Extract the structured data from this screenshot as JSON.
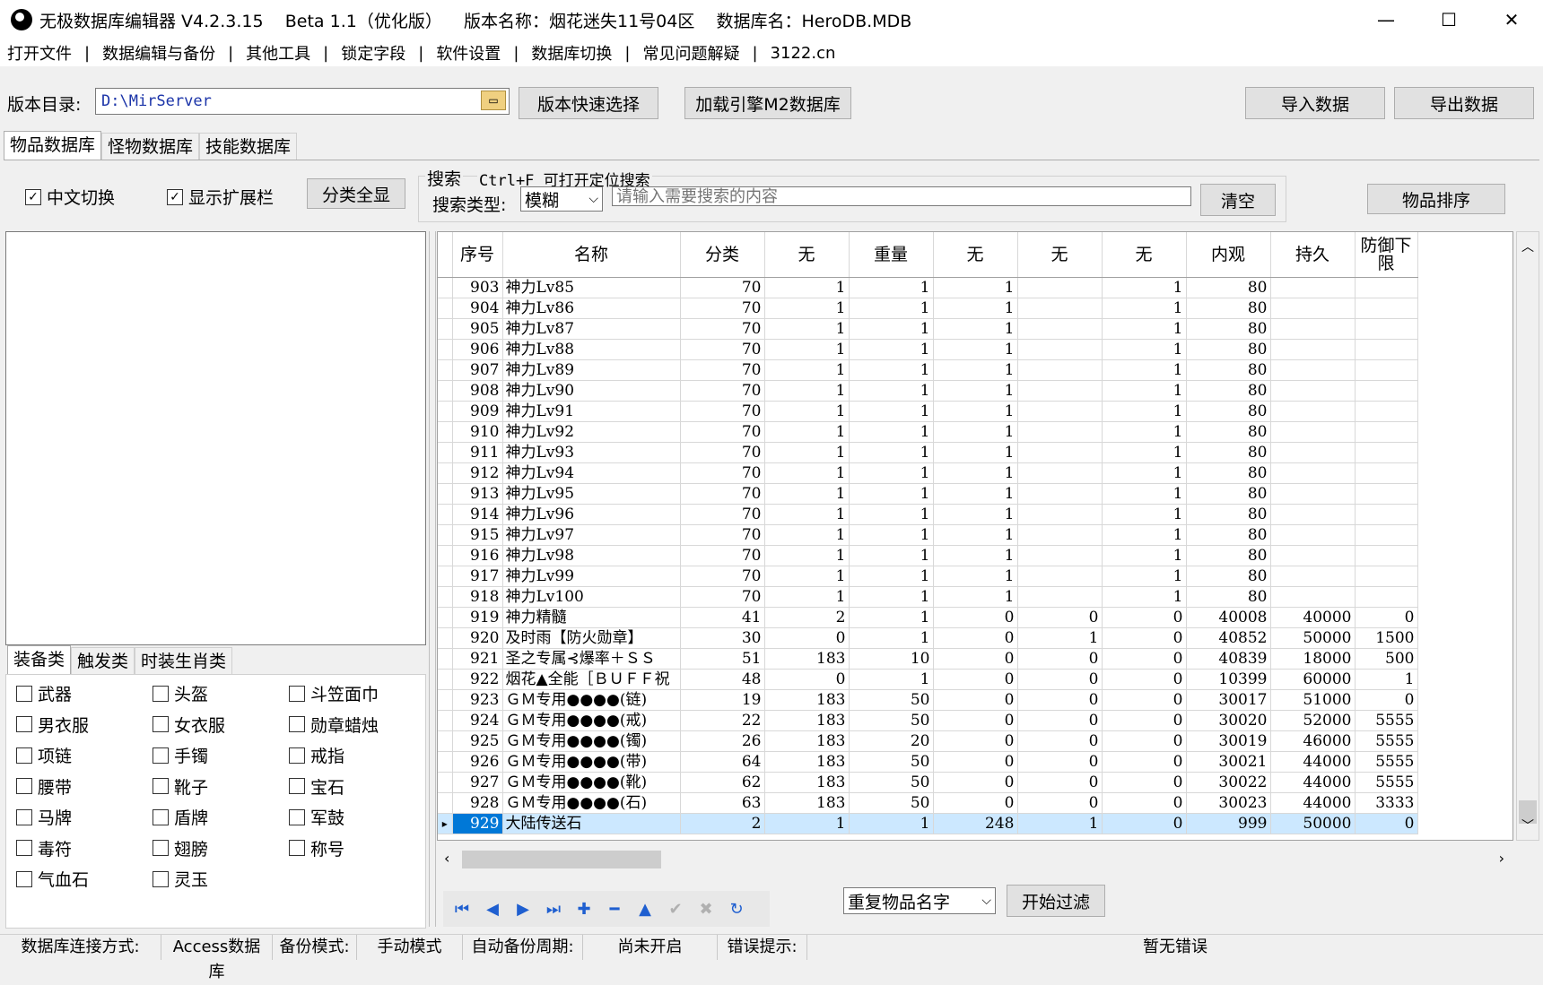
{
  "titlebar": {
    "title": "无极数据库编辑器 V4.2.3.15    Beta 1.1（优化版）    版本名称：烟花迷失11号04区    数据库名：HeroDB.MDB",
    "minimize": "—",
    "maximize": "☐",
    "close": "✕"
  },
  "menu": {
    "items": [
      "打开文件",
      "数据编辑与备份",
      "其他工具",
      "锁定字段",
      "软件设置",
      "数据库切换",
      "常见问题解疑",
      "3122.cn"
    ],
    "separator": "|"
  },
  "toolbar": {
    "dir_label": "版本目录:",
    "dir_value": "D:\\MirServer",
    "quick_select": "版本快速选择",
    "load_m2": "加载引擎M2数据库",
    "import": "导入数据",
    "export": "导出数据"
  },
  "tabs": [
    "物品数据库",
    "怪物数据库",
    "技能数据库"
  ],
  "options": {
    "chinese_switch": "中文切换",
    "show_ext": "显示扩展栏",
    "show_all": "分类全显",
    "search_title": "搜索",
    "search_hint": "Ctrl+F 可打开定位搜索",
    "search_type_label": "搜索类型:",
    "search_type": "模糊",
    "search_placeholder": "请输入需要搜索的内容",
    "clear": "清空",
    "sort": "物品排序"
  },
  "category_tabs": [
    "装备类",
    "触发类",
    "时装生肖类"
  ],
  "categories": [
    "武器",
    "头盔",
    "斗笠面巾",
    "男衣服",
    "女衣服",
    "勋章蜡烛",
    "项链",
    "手镯",
    "戒指",
    "腰带",
    "靴子",
    "宝石",
    "马牌",
    "盾牌",
    "军鼓",
    "毒符",
    "翅膀",
    "称号",
    "气血石",
    "灵玉"
  ],
  "grid": {
    "columns": [
      "序号",
      "名称",
      "分类",
      "无",
      "重量",
      "无",
      "无",
      "无",
      "内观",
      "持久",
      "防御下限"
    ],
    "rows": [
      [
        "903",
        "神力Lv85",
        "70",
        "1",
        "1",
        "1",
        "",
        "1",
        "80",
        "",
        ""
      ],
      [
        "904",
        "神力Lv86",
        "70",
        "1",
        "1",
        "1",
        "",
        "1",
        "80",
        "",
        ""
      ],
      [
        "905",
        "神力Lv87",
        "70",
        "1",
        "1",
        "1",
        "",
        "1",
        "80",
        "",
        ""
      ],
      [
        "906",
        "神力Lv88",
        "70",
        "1",
        "1",
        "1",
        "",
        "1",
        "80",
        "",
        ""
      ],
      [
        "907",
        "神力Lv89",
        "70",
        "1",
        "1",
        "1",
        "",
        "1",
        "80",
        "",
        ""
      ],
      [
        "908",
        "神力Lv90",
        "70",
        "1",
        "1",
        "1",
        "",
        "1",
        "80",
        "",
        ""
      ],
      [
        "909",
        "神力Lv91",
        "70",
        "1",
        "1",
        "1",
        "",
        "1",
        "80",
        "",
        ""
      ],
      [
        "910",
        "神力Lv92",
        "70",
        "1",
        "1",
        "1",
        "",
        "1",
        "80",
        "",
        ""
      ],
      [
        "911",
        "神力Lv93",
        "70",
        "1",
        "1",
        "1",
        "",
        "1",
        "80",
        "",
        ""
      ],
      [
        "912",
        "神力Lv94",
        "70",
        "1",
        "1",
        "1",
        "",
        "1",
        "80",
        "",
        ""
      ],
      [
        "913",
        "神力Lv95",
        "70",
        "1",
        "1",
        "1",
        "",
        "1",
        "80",
        "",
        ""
      ],
      [
        "914",
        "神力Lv96",
        "70",
        "1",
        "1",
        "1",
        "",
        "1",
        "80",
        "",
        ""
      ],
      [
        "915",
        "神力Lv97",
        "70",
        "1",
        "1",
        "1",
        "",
        "1",
        "80",
        "",
        ""
      ],
      [
        "916",
        "神力Lv98",
        "70",
        "1",
        "1",
        "1",
        "",
        "1",
        "80",
        "",
        ""
      ],
      [
        "917",
        "神力Lv99",
        "70",
        "1",
        "1",
        "1",
        "",
        "1",
        "80",
        "",
        ""
      ],
      [
        "918",
        "神力Lv100",
        "70",
        "1",
        "1",
        "1",
        "",
        "1",
        "80",
        "",
        ""
      ],
      [
        "919",
        "神力精髓",
        "41",
        "2",
        "1",
        "0",
        "0",
        "0",
        "40008",
        "40000",
        "0"
      ],
      [
        "920",
        "及时雨【防火勋章】",
        "30",
        "0",
        "1",
        "0",
        "1",
        "0",
        "40852",
        "50000",
        "1500"
      ],
      [
        "921",
        "圣之专属⊰爆率＋ＳＳ",
        "51",
        "183",
        "10",
        "0",
        "0",
        "0",
        "40839",
        "18000",
        "500"
      ],
      [
        "922",
        "烟花▲全能［ＢＵＦＦ祝",
        "48",
        "0",
        "1",
        "0",
        "0",
        "0",
        "10399",
        "60000",
        "1"
      ],
      [
        "923",
        "ＧＭ专用●●●●(链)",
        "19",
        "183",
        "50",
        "0",
        "0",
        "0",
        "30017",
        "51000",
        "0"
      ],
      [
        "924",
        "ＧＭ专用●●●●(戒)",
        "22",
        "183",
        "50",
        "0",
        "0",
        "0",
        "30020",
        "52000",
        "5555"
      ],
      [
        "925",
        "ＧＭ专用●●●●(镯)",
        "26",
        "183",
        "20",
        "0",
        "0",
        "0",
        "30019",
        "46000",
        "5555"
      ],
      [
        "926",
        "ＧＭ专用●●●●(带)",
        "64",
        "183",
        "50",
        "0",
        "0",
        "0",
        "30021",
        "44000",
        "5555"
      ],
      [
        "927",
        "ＧＭ专用●●●●(靴)",
        "62",
        "183",
        "50",
        "0",
        "0",
        "0",
        "30022",
        "44000",
        "5555"
      ],
      [
        "928",
        "ＧＭ专用●●●●(石)",
        "63",
        "183",
        "50",
        "0",
        "0",
        "0",
        "30023",
        "44000",
        "3333"
      ],
      [
        "929",
        "大陆传送石",
        "2",
        "1",
        "1",
        "248",
        "1",
        "0",
        "999",
        "50000",
        "0"
      ]
    ],
    "selected_row": "929"
  },
  "bottom": {
    "filter_type": "重复物品名字",
    "start_filter": "开始过滤"
  },
  "status": {
    "conn_label": "数据库连接方式:",
    "conn_value": "Access数据库",
    "backup_label": "备份模式:",
    "backup_value": "手动模式",
    "auto_label": "自动备份周期:",
    "auto_value": "尚未开启",
    "err_label": "错误提示:",
    "err_value": "暂无错误"
  }
}
